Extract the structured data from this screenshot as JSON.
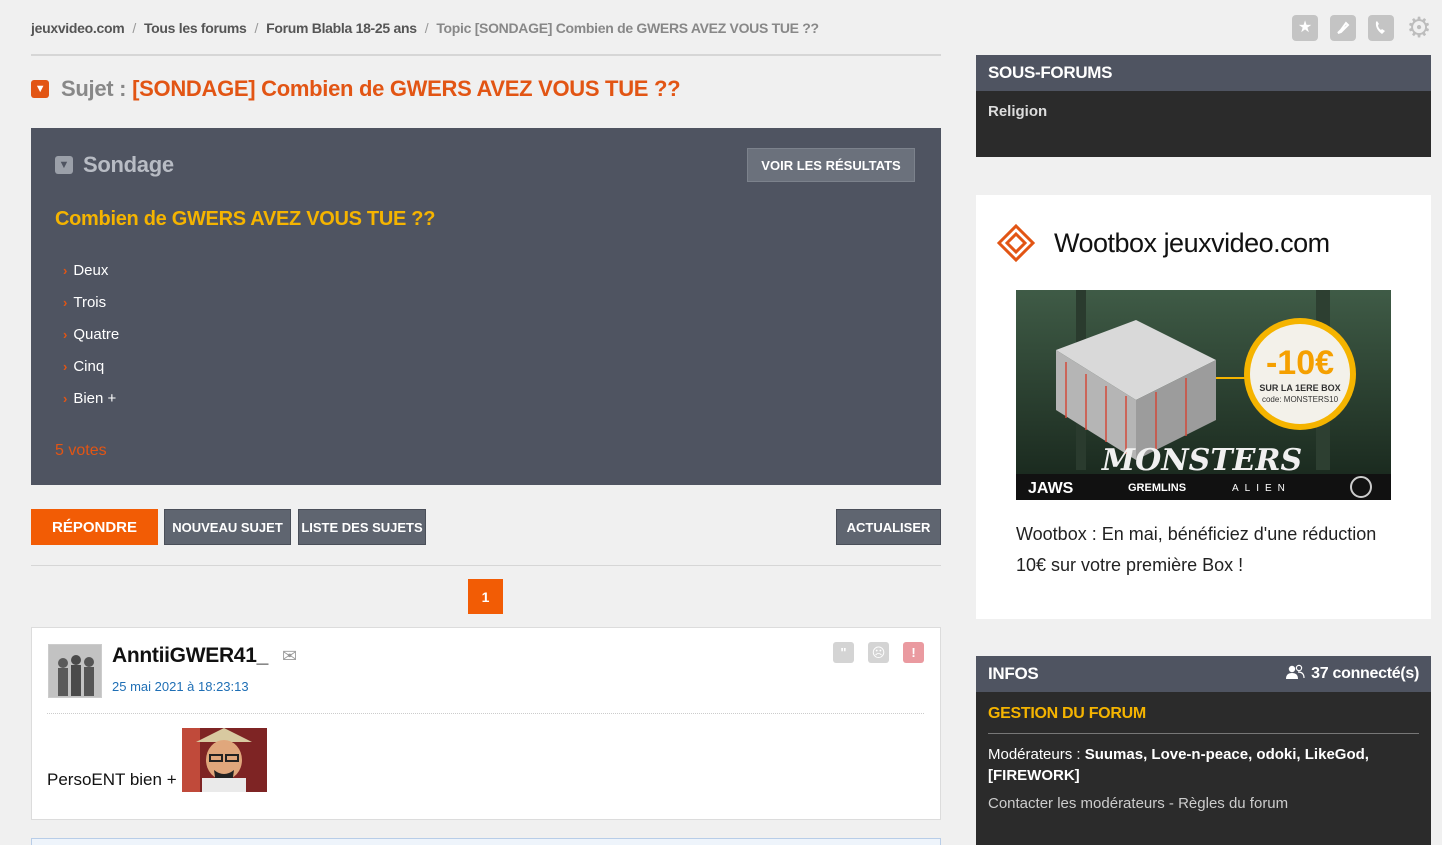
{
  "breadcrumb": {
    "items": [
      "jeuxvideo.com",
      "Tous les forums",
      "Forum Blabla 18-25 ans",
      "Topic [SONDAGE] Combien de GWERS AVEZ VOUS TUE ??"
    ],
    "separator": "/"
  },
  "top_icons": [
    "star-icon",
    "bookmark-icon",
    "phone-icon",
    "gear-icon"
  ],
  "topic": {
    "label": "Sujet :",
    "title": "[SONDAGE] Combien de GWERS AVEZ VOUS TUE ??"
  },
  "poll": {
    "title": "Sondage",
    "results_button": "VOIR LES RÉSULTATS",
    "question": "Combien de GWERS AVEZ VOUS TUE ??",
    "options": [
      "Deux",
      "Trois",
      "Quatre",
      "Cinq",
      "Bien +"
    ],
    "votes": "5 votes"
  },
  "actions": {
    "reply": "RÉPONDRE",
    "new_topic": "NOUVEAU SUJET",
    "topic_list": "LISTE DES SUJETS",
    "refresh": "ACTUALISER"
  },
  "pagination": {
    "current": "1"
  },
  "post": {
    "author": "AnntiiGWER41_",
    "date": "25 mai 2021 à 18:23:13",
    "text": "PersoENT bien +"
  },
  "sidebar": {
    "subforums": {
      "title": "SOUS-FORUMS",
      "items": [
        "Religion"
      ]
    },
    "wootbox": {
      "title": "Wootbox jeuxvideo.com",
      "banner": {
        "promo": "-10€",
        "promo_sub": "SUR LA 1ERE BOX",
        "code": "code: MONSTERS10",
        "headline": "MONSTERS",
        "brands": [
          "JAWS",
          "GREMLINS",
          "ALIEN"
        ]
      },
      "description": "Wootbox : En mai, bénéficiez d'une réduction 10€ sur votre première Box !"
    },
    "infos": {
      "title": "INFOS",
      "connected": "37 connecté(s)",
      "gestion_title": "GESTION DU FORUM",
      "moderators_label": "Modérateurs :",
      "moderators": "Suumas, Love-n-peace, odoki, LikeGod, [FIREWORK]",
      "contact": "Contacter les modérateurs",
      "contact_sep": " - ",
      "rules": "Règles du forum"
    }
  },
  "colors": {
    "accent": "#e25514",
    "button_orange": "#f25c05",
    "poll_bg": "#4f5461",
    "question": "#f5b400",
    "dark_panel": "#2b2b2b"
  }
}
